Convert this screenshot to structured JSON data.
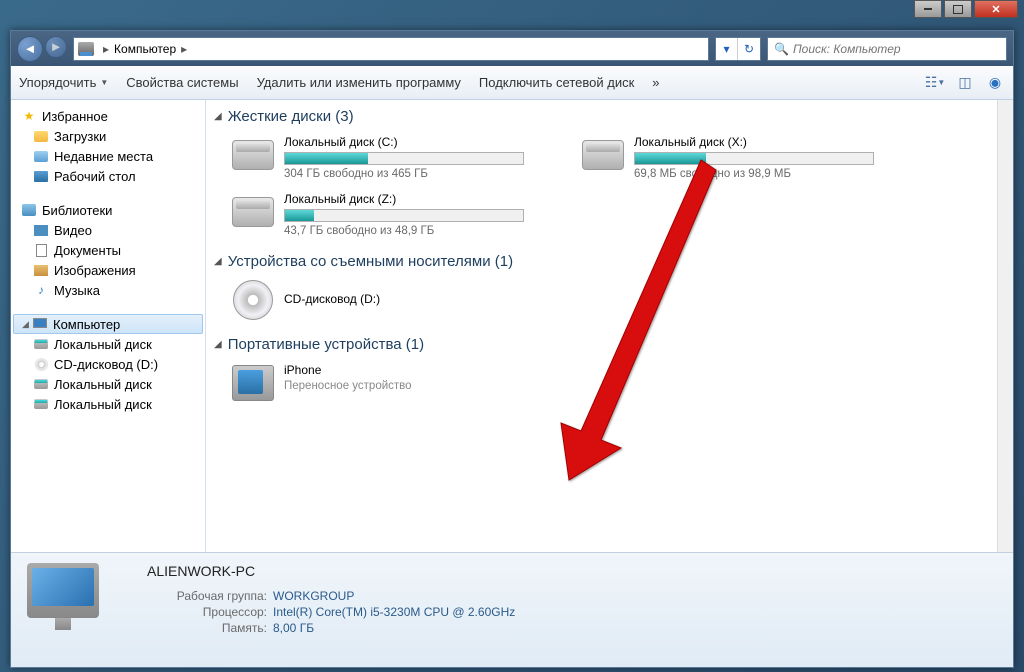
{
  "titlebar": {
    "min": "",
    "max": "",
    "close": ""
  },
  "addressbar": {
    "location": "Компьютер",
    "search_placeholder": "Поиск: Компьютер"
  },
  "toolbar": {
    "organize": "Упорядочить",
    "system_props": "Свойства системы",
    "uninstall": "Удалить или изменить программу",
    "map_drive": "Подключить сетевой диск",
    "more": "»"
  },
  "sidebar": {
    "favorites": {
      "label": "Избранное",
      "items": [
        "Загрузки",
        "Недавние места",
        "Рабочий стол"
      ]
    },
    "libraries": {
      "label": "Библиотеки",
      "items": [
        "Видео",
        "Документы",
        "Изображения",
        "Музыка"
      ]
    },
    "computer": {
      "label": "Компьютер",
      "items": [
        "Локальный диск",
        "CD-дисковод (D:)",
        "Локальный диск",
        "Локальный диск"
      ]
    }
  },
  "main": {
    "cat_hdd": "Жесткие диски (3)",
    "cat_removable": "Устройства со съемными носителями (1)",
    "cat_portable": "Портативные устройства (1)",
    "drives": {
      "c": {
        "name": "Локальный диск (C:)",
        "free": "304 ГБ свободно из 465 ГБ",
        "fill": 35
      },
      "x": {
        "name": "Локальный диск (X:)",
        "free": "69,8 МБ свободно из 98,9 МБ",
        "fill": 30
      },
      "z": {
        "name": "Локальный диск (Z:)",
        "free": "43,7 ГБ свободно из 48,9 ГБ",
        "fill": 12
      }
    },
    "cd": {
      "name": "CD-дисковод (D:)"
    },
    "iphone": {
      "name": "iPhone",
      "sub": "Переносное устройство"
    }
  },
  "details": {
    "title": "ALIENWORK-PC",
    "rows": [
      {
        "label": "Рабочая группа:",
        "value": "WORKGROUP"
      },
      {
        "label": "Процессор:",
        "value": "Intel(R) Core(TM) i5-3230M CPU @ 2.60GHz"
      },
      {
        "label": "Память:",
        "value": "8,00 ГБ"
      }
    ]
  }
}
